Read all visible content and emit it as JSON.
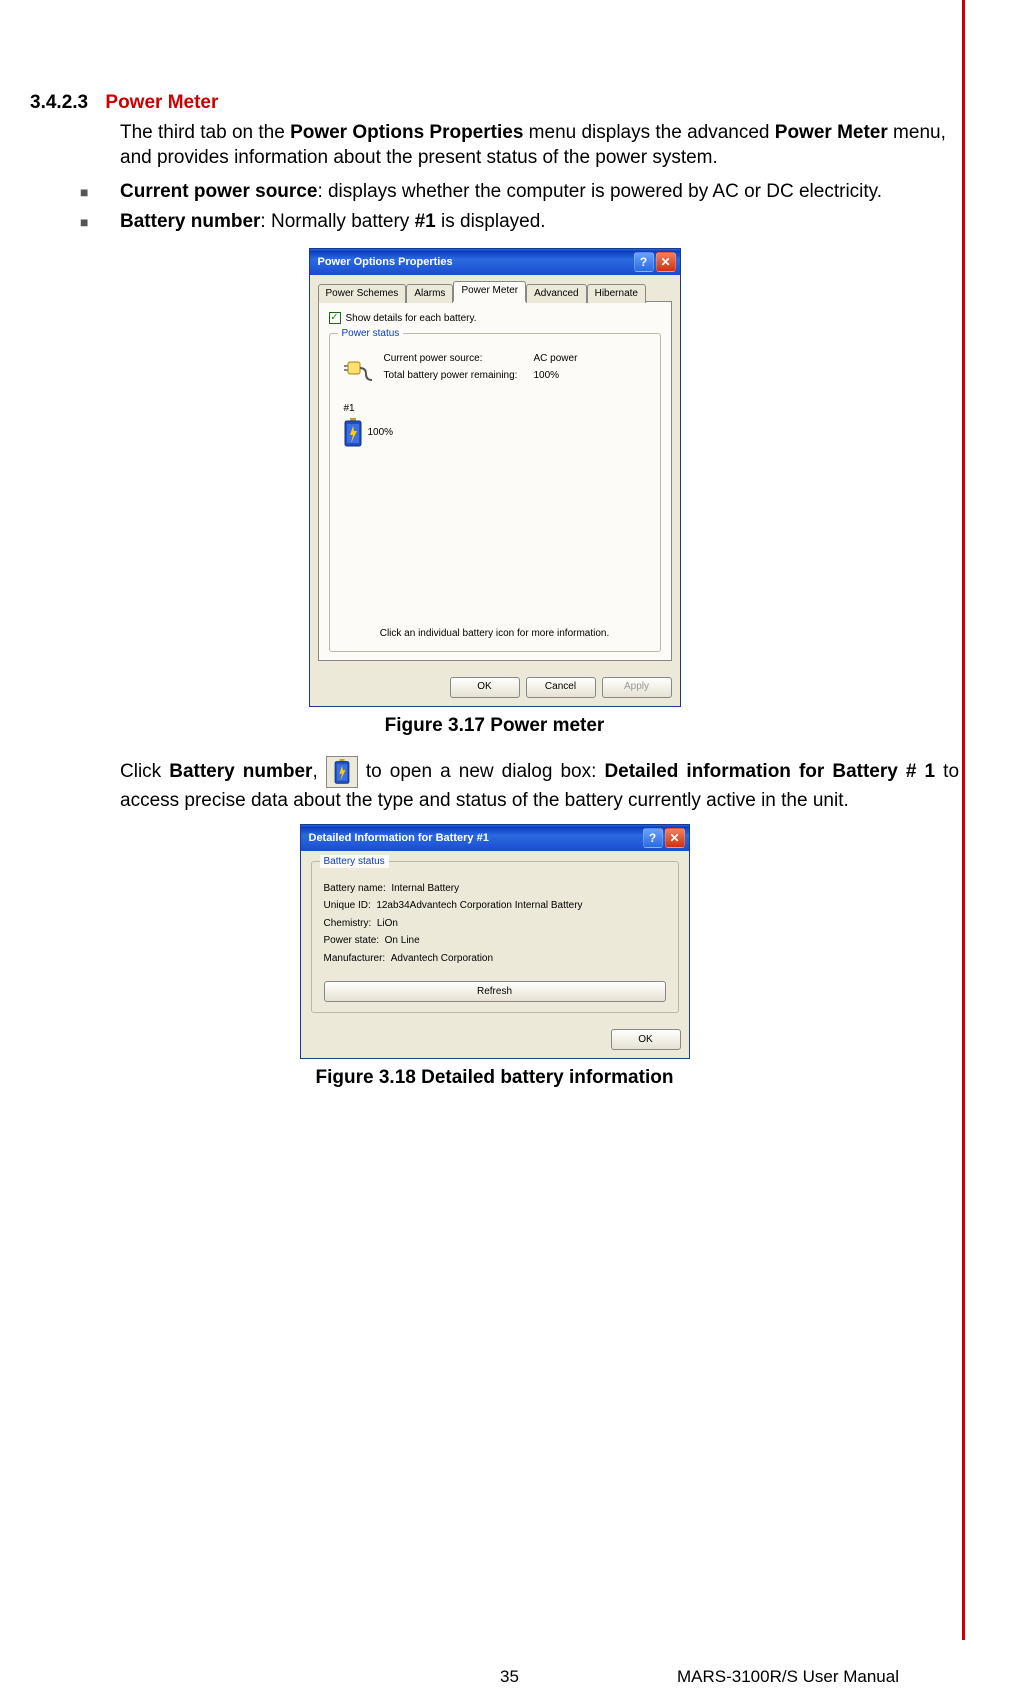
{
  "section": {
    "number": "3.4.2.3",
    "title": "Power Meter"
  },
  "intro": {
    "p1a": "The third tab on the ",
    "p1b": "Power Options Properties",
    "p1c": " menu displays the advanced ",
    "p1d": "Power Meter",
    "p1e": " menu, and provides information about the present status of the power system."
  },
  "bullets": {
    "b1_bold": "Current power source",
    "b1_rest": ": displays whether the computer is powered by AC or DC electricity.",
    "b2_bold": "Battery number",
    "b2_rest": ": Normally battery ",
    "b2_hash": "#1",
    "b2_tail": " is displayed."
  },
  "dialog1": {
    "title": "Power Options Properties",
    "tabs": {
      "t1": "Power Schemes",
      "t2": "Alarms",
      "t3": "Power Meter",
      "t4": "Advanced",
      "t5": "Hibernate"
    },
    "checkbox": "Show details for each battery.",
    "group": "Power status",
    "row1_label": "Current power source:",
    "row1_value": "AC power",
    "row2_label": "Total battery power remaining:",
    "row2_value": "100%",
    "batt_num": "#1",
    "batt_pct": "100%",
    "hint": "Click an individual battery icon for more information.",
    "ok": "OK",
    "cancel": "Cancel",
    "apply": "Apply"
  },
  "fig1": "Figure 3.17 Power meter",
  "mid": {
    "a": "Click ",
    "b": "Battery number",
    "c": ", ",
    "d": " to open a new dialog box: ",
    "e": "Detailed information for Battery # 1",
    "f": " to access precise data about the type and status of the battery currently active in the unit."
  },
  "dialog2": {
    "title": "Detailed Information for Battery #1",
    "group": "Battery status",
    "name_l": "Battery name:",
    "name_v": "Internal Battery",
    "uid_l": "Unique ID:",
    "uid_v": "12ab34Advantech Corporation Internal Battery",
    "chem_l": "Chemistry:",
    "chem_v": "LiOn",
    "pstate_l": "Power state:",
    "pstate_v": "On Line",
    "manu_l": "Manufacturer:",
    "manu_v": "Advantech Corporation",
    "refresh": "Refresh",
    "ok": "OK"
  },
  "fig2": "Figure 3.18 Detailed battery information",
  "footer": {
    "page": "35",
    "title": "MARS-3100R/S User Manual"
  }
}
